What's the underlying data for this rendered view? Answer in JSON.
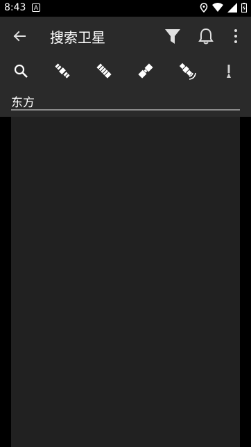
{
  "status": {
    "time": "8:43",
    "a_badge": "A"
  },
  "appbar": {
    "title": "搜索卫星"
  },
  "search": {
    "value": "东方"
  }
}
